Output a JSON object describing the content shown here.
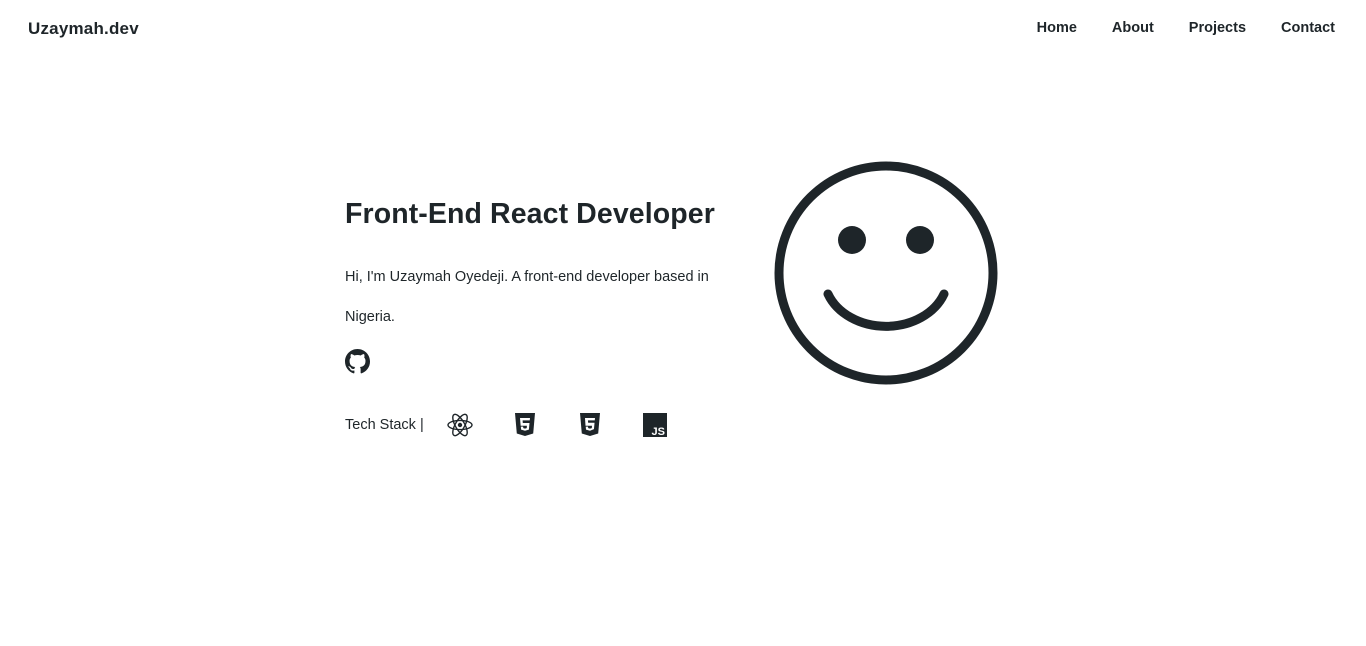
{
  "header": {
    "brand": "Uzaymah.dev",
    "nav": [
      {
        "label": "Home"
      },
      {
        "label": "About"
      },
      {
        "label": "Projects"
      },
      {
        "label": "Contact"
      }
    ]
  },
  "hero": {
    "title": "Front-End React Developer",
    "intro": "Hi, I'm Uzaymah Oyedeji. A front-end developer based in Nigeria.",
    "social": [
      {
        "icon": "github-icon"
      }
    ],
    "tech_stack_label": "Tech Stack |",
    "tech_stack_icons": [
      "react-icon",
      "html5-icon",
      "css3-icon",
      "javascript-icon"
    ],
    "js_badge_text": "JS",
    "illustration_icon": "smiley-face-icon"
  },
  "colors": {
    "text": "#1e2529",
    "background": "#ffffff"
  }
}
